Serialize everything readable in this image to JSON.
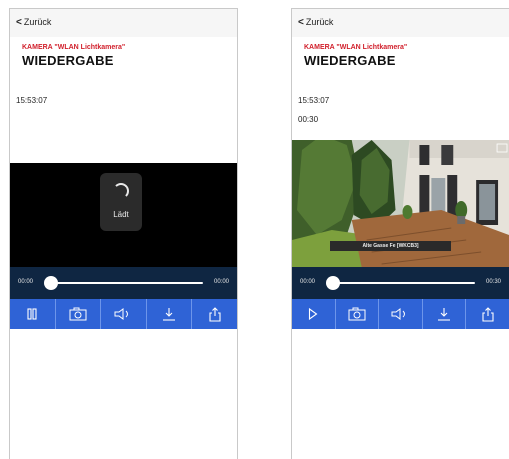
{
  "left": {
    "back_label": "Zurück",
    "camera_label": "KAMERA \"WLAN Lichtkamera\"",
    "title": "WIEDERGABE",
    "timestamp": "15:53:07",
    "loading_label": "Lädt",
    "seek": {
      "start": "00:00",
      "end": "00:00",
      "progress": 0
    },
    "controls": [
      "pause-icon",
      "snapshot-icon",
      "volume-icon",
      "download-icon",
      "share-icon"
    ]
  },
  "right": {
    "back_label": "Zurück",
    "camera_label": "KAMERA \"WLAN Lichtkamera\"",
    "title": "WIEDERGABE",
    "timestamp": "15:53:07",
    "duration": "00:30",
    "video_caption": "Alte Gasse Fe [WKCB3]",
    "seek": {
      "start": "00:00",
      "end": "00:30",
      "progress": 0
    },
    "controls": [
      "play-icon",
      "snapshot-icon",
      "volume-icon",
      "download-icon",
      "share-icon"
    ]
  },
  "colors": {
    "accent_red": "#d11f2b",
    "control_bar": "#2f63d6",
    "seek_bar": "#0f2642"
  }
}
